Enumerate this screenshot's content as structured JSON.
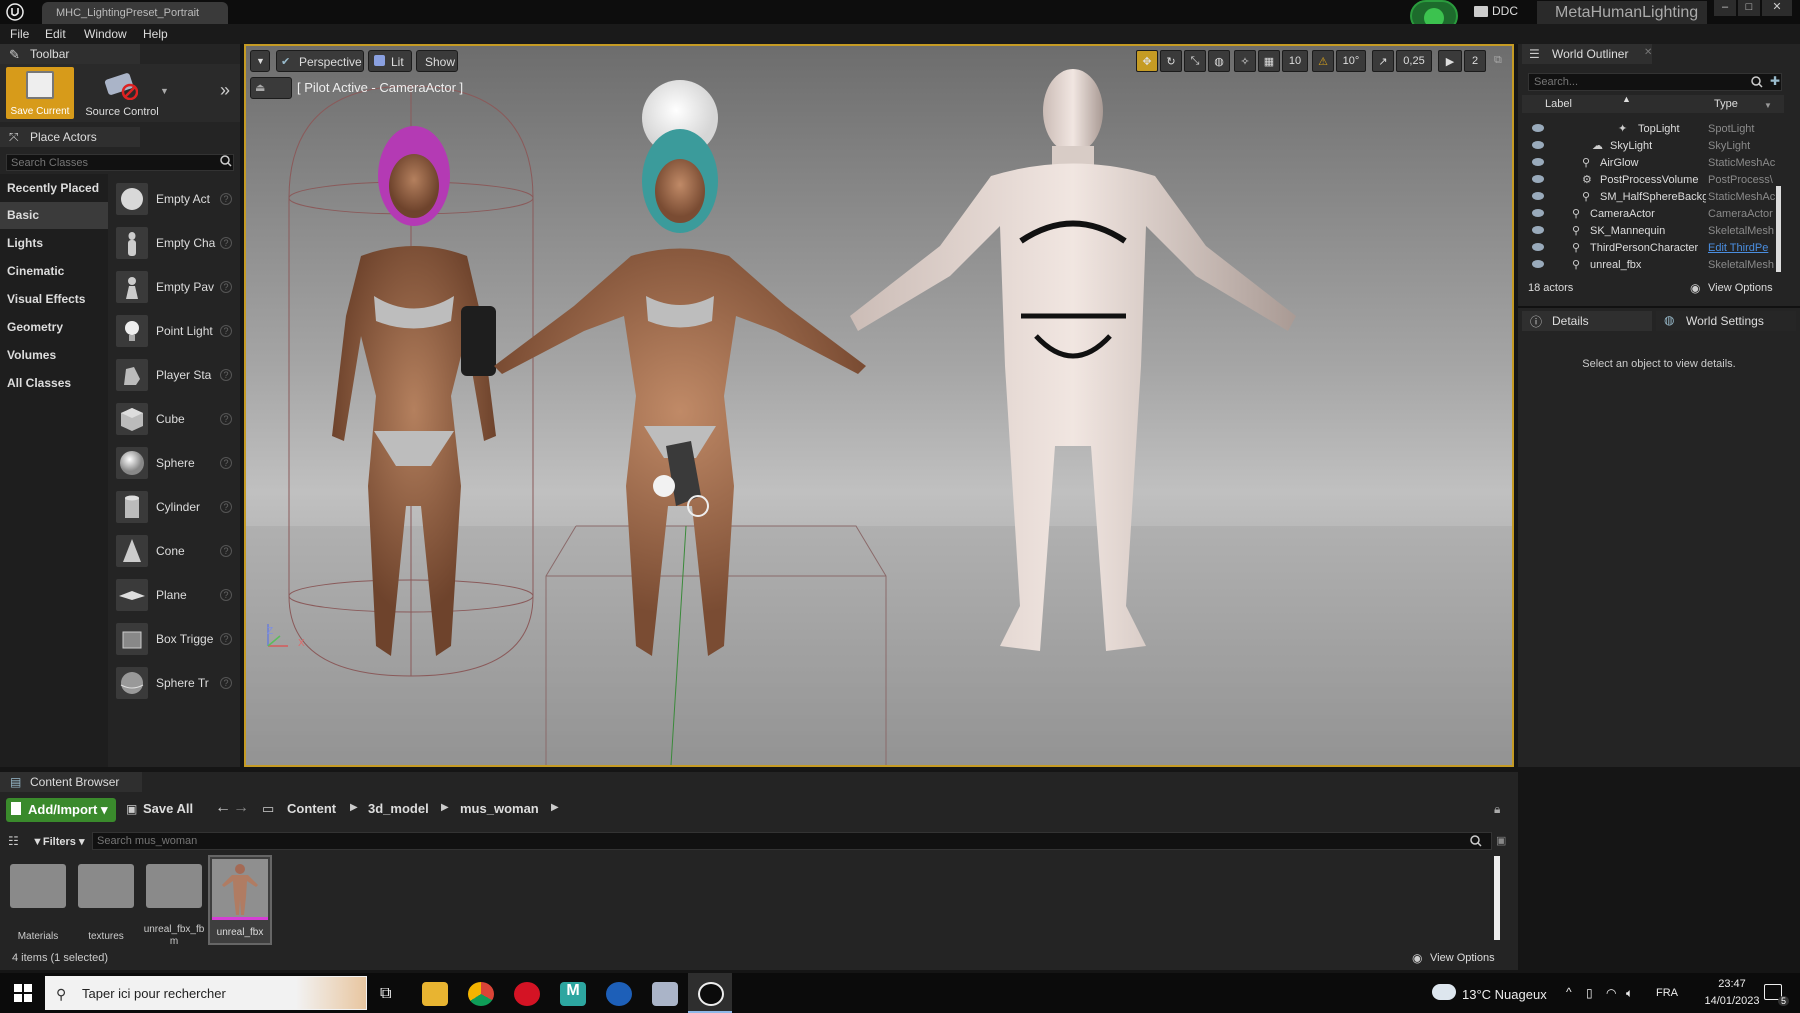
{
  "window": {
    "tab_title": "MHC_LightingPreset_Portrait",
    "ddc_label": "DDC",
    "project_name": "MetaHumanLighting"
  },
  "menu": [
    "File",
    "Edit",
    "Window",
    "Help"
  ],
  "toolbar": {
    "panel_title": "Toolbar",
    "save_label": "Save Current",
    "source_control_label": "Source Control"
  },
  "place_actors": {
    "panel_title": "Place Actors",
    "search_placeholder": "Search Classes",
    "categories": [
      "Recently Placed",
      "Basic",
      "Lights",
      "Cinematic",
      "Visual Effects",
      "Geometry",
      "Volumes",
      "All Classes"
    ],
    "selected_category": "Basic",
    "items": [
      "Empty Act",
      "Empty Cha",
      "Empty Pav",
      "Point Light",
      "Player Sta",
      "Cube",
      "Sphere",
      "Cylinder",
      "Cone",
      "Plane",
      "Box Trigge",
      "Sphere Tr"
    ]
  },
  "viewport": {
    "perspective_label": "Perspective",
    "lit_label": "Lit",
    "show_label": "Show",
    "pilot_label": "[ Pilot Active - CameraActor ]",
    "grid_snap": "10",
    "rotation_snap": "10°",
    "scale_snap": "0,25",
    "camera_speed": "2",
    "axis_z": "Z",
    "axis_x": "X"
  },
  "world_outliner": {
    "panel_title": "World Outliner",
    "search_placeholder": "Search...",
    "col_label": "Label",
    "col_type": "Type",
    "rows": [
      {
        "label": "TopLight",
        "type": "SpotLight"
      },
      {
        "label": "SkyLight",
        "type": "SkyLight"
      },
      {
        "label": "AirGlow",
        "type": "StaticMeshAc"
      },
      {
        "label": "PostProcessVolume",
        "type": "PostProcess\\"
      },
      {
        "label": "SM_HalfSphereBackg",
        "type": "StaticMeshAc"
      },
      {
        "label": "CameraActor",
        "type": "CameraActor"
      },
      {
        "label": "SK_Mannequin",
        "type": "SkeletalMesh"
      },
      {
        "label": "ThirdPersonCharacter",
        "type": "Edit ThirdPe"
      },
      {
        "label": "unreal_fbx",
        "type": "SkeletalMesh"
      }
    ],
    "actor_count": "18 actors",
    "view_options": "View Options"
  },
  "details": {
    "tab_details": "Details",
    "tab_world_settings": "World Settings",
    "empty_message": "Select an object to view details."
  },
  "content_browser": {
    "panel_title": "Content Browser",
    "add_import": "Add/Import",
    "save_all": "Save All",
    "breadcrumb": [
      "Content",
      "3d_model",
      "mus_woman"
    ],
    "filters": "Filters",
    "search_placeholder": "Search mus_woman",
    "assets": [
      {
        "name": "Materials",
        "kind": "folder"
      },
      {
        "name": "textures",
        "kind": "folder"
      },
      {
        "name": "unreal_fbx_fbm",
        "kind": "folder"
      },
      {
        "name": "unreal_fbx",
        "kind": "mesh"
      }
    ],
    "status": "4 items (1 selected)",
    "view_options": "View Options"
  },
  "taskbar": {
    "search_placeholder": "Taper ici pour rechercher",
    "weather": "13°C  Nuageux",
    "lang": "FRA",
    "time": "23:47",
    "date": "14/01/2023",
    "notif_count": "5"
  }
}
